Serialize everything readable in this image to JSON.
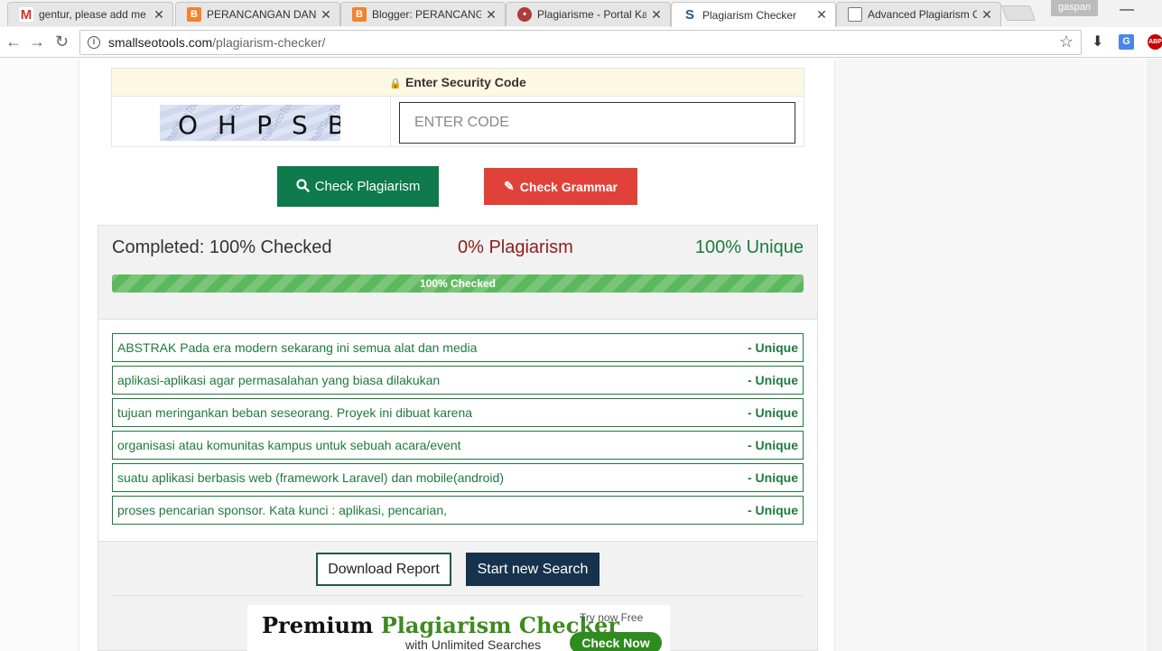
{
  "browser": {
    "tabs": [
      {
        "title": "gentur, please add me",
        "icon": "gmail-icon",
        "color": "#d93025"
      },
      {
        "title": "PERANCANGAN DAN",
        "icon": "blogger-icon",
        "color": "#f4822b"
      },
      {
        "title": "Blogger: PERANCANGA",
        "icon": "blogger-icon",
        "color": "#f4822b"
      },
      {
        "title": "Plagiarisme - Portal Ka",
        "icon": "portal-icon",
        "color": "#b23a3a"
      },
      {
        "title": "Plagiarism Checker",
        "icon": "smallseotools-icon",
        "color": "#1f5c8a"
      },
      {
        "title": "Advanced Plagiarism C",
        "icon": "document-icon",
        "color": "#777777"
      }
    ],
    "profile_name": "gaspan",
    "url_host": "smallseotools.com",
    "url_path": "/plagiarism-checker/"
  },
  "captcha": {
    "heading": "Enter Security Code",
    "code_image_text": "OHPSB",
    "input_placeholder": "ENTER CODE",
    "input_value": ""
  },
  "actions": {
    "check_plagiarism": "Check Plagiarism",
    "check_grammar": "Check Grammar"
  },
  "results": {
    "completed": "Completed: 100% Checked",
    "plagiarism": "0% Plagiarism",
    "unique": "100% Unique",
    "progress_label": "100% Checked",
    "progress_fraction": 1.0,
    "sentences": [
      {
        "text": "ABSTRAK Pada era modern sekarang ini semua alat dan media",
        "status": "- Unique"
      },
      {
        "text": "aplikasi-aplikasi agar permasalahan yang biasa dilakukan",
        "status": "- Unique"
      },
      {
        "text": "tujuan meringankan beban seseorang. Proyek ini dibuat karena",
        "status": "- Unique"
      },
      {
        "text": "organisasi atau komunitas kampus untuk sebuah acara/event",
        "status": "- Unique"
      },
      {
        "text": "suatu aplikasi berbasis web (framework Laravel) dan mobile(android)",
        "status": "- Unique"
      },
      {
        "text": "proses pencarian sponsor. Kata kunci : aplikasi, pencarian,",
        "status": "- Unique"
      }
    ],
    "download_report": "Download Report",
    "start_new_search": "Start new Search"
  },
  "banner": {
    "title_start": "Premium",
    "title_highlight": "Plagiarism Checker",
    "subtitle": "with Unlimited Searches",
    "try_text": "Try now Free",
    "cta": "Check Now"
  },
  "colors": {
    "check_button": "#0f7a4b",
    "grammar_button": "#e0423a",
    "unique_green": "#1f7a3e",
    "plagiarism_red": "#8b1d1d",
    "new_search_navy": "#17324d"
  }
}
